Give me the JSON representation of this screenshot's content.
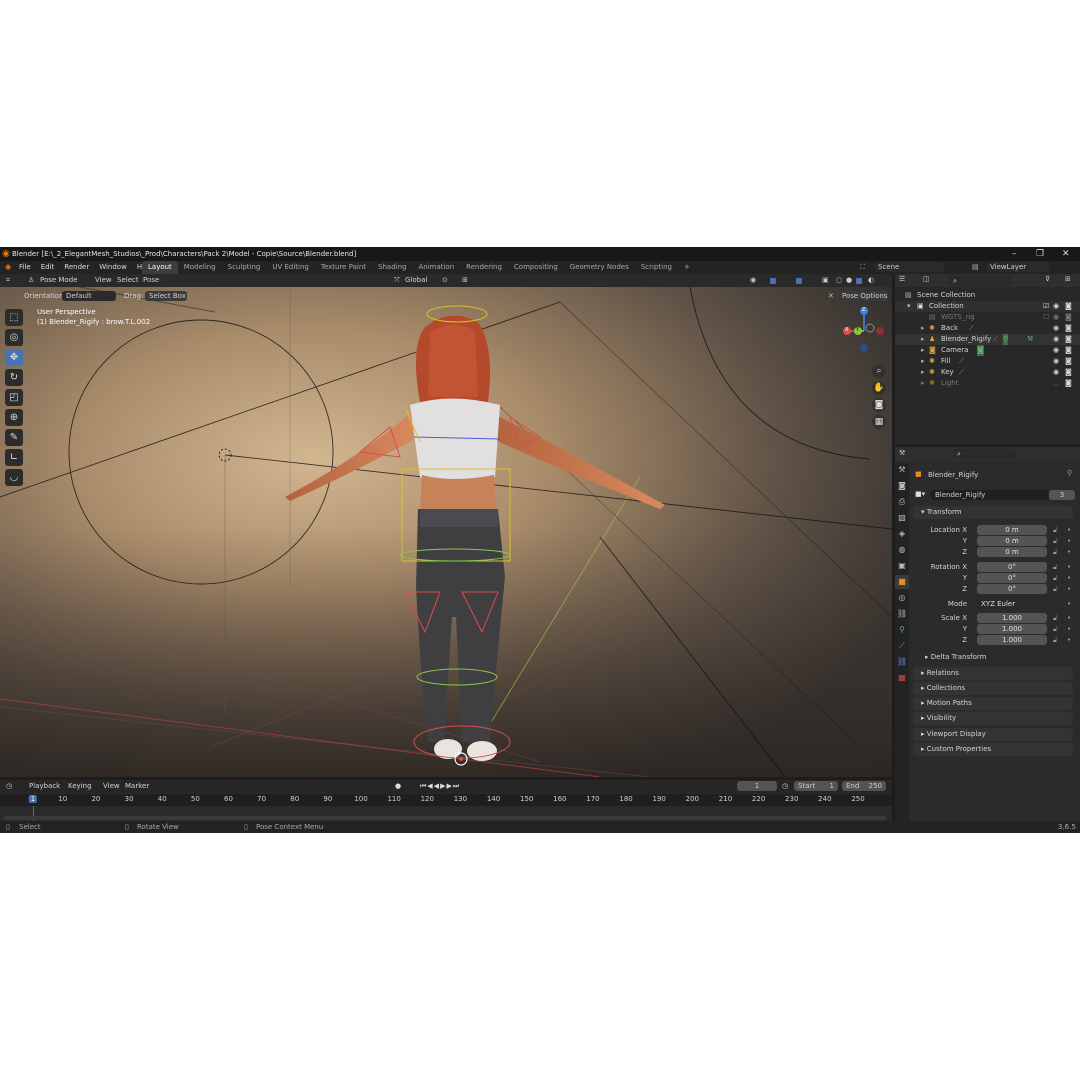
{
  "window": {
    "title": "Blender [E:\\_2_ElegantMesh_Studios\\_Prod\\Characters\\Pack 2\\Model - Copie\\Source\\Blender.blend]",
    "minimize": "–",
    "maximize": "❐",
    "close": "✕"
  },
  "menu": {
    "items": [
      "File",
      "Edit",
      "Render",
      "Window",
      "Help"
    ],
    "workspaces": [
      "Layout",
      "Modeling",
      "Sculpting",
      "UV Editing",
      "Texture Paint",
      "Shading",
      "Animation",
      "Rendering",
      "Compositing",
      "Geometry Nodes",
      "Scripting"
    ],
    "active_workspace": "Layout",
    "add_tab": "+",
    "scene": "Scene",
    "view_layer": "ViewLayer"
  },
  "viewport_header": {
    "mode": "Pose Mode",
    "menus": [
      "View",
      "Select",
      "Pose"
    ],
    "orientation_label": "Orientation:",
    "orientation_value": "Default",
    "drag_label": "Drag:",
    "drag_value": "Select Box",
    "transform_global": "Global",
    "pose_options": "Pose Options"
  },
  "viewport": {
    "perspective": "User Perspective",
    "active_object": "(1) Blender_Rigify : brow.T.L.002",
    "gizmo": {
      "x": "X",
      "y": "Y",
      "z": "Z"
    }
  },
  "outliner": {
    "root": "Scene Collection",
    "collection": "Collection",
    "items": [
      "WGTS_rig",
      "Back",
      "Blender_Rigify",
      "Camera",
      "Fill",
      "Key",
      "Light"
    ]
  },
  "properties": {
    "object_name": "Blender_Rigify",
    "data_name": "Blender_Rigify",
    "users": "3",
    "transform_title": "Transform",
    "location_label": "Location X",
    "location": [
      "0 m",
      "0 m",
      "0 m"
    ],
    "rotation_label": "Rotation X",
    "rotation": [
      "0°",
      "0°",
      "0°"
    ],
    "axis_y": "Y",
    "axis_z": "Z",
    "mode_label": "Mode",
    "mode_value": "XYZ Euler",
    "scale_label": "Scale X",
    "scale": [
      "1.000",
      "1.000",
      "1.000"
    ],
    "delta_transform": "Delta Transform",
    "panels": [
      "Relations",
      "Collections",
      "Motion Paths",
      "Visibility",
      "Viewport Display",
      "Custom Properties"
    ]
  },
  "timeline": {
    "menus": [
      "Playback",
      "Keying",
      "View",
      "Marker"
    ],
    "current_frame": "1",
    "start_label": "Start",
    "start": "1",
    "end_label": "End",
    "end": "250",
    "ticks": [
      "1",
      "10",
      "20",
      "30",
      "40",
      "50",
      "60",
      "70",
      "80",
      "90",
      "100",
      "110",
      "120",
      "130",
      "140",
      "150",
      "160",
      "170",
      "180",
      "190",
      "200",
      "210",
      "220",
      "230",
      "240",
      "250"
    ]
  },
  "statusbar": {
    "select": "Select",
    "rotate": "Rotate View",
    "context": "Pose Context Menu",
    "version": "3.6.5"
  },
  "colors": {
    "accent": "#4772b3",
    "bg": "#1d1d1d",
    "panel": "#2b2b2b",
    "axis_x": "#e44b55",
    "axis_y": "#8bc53f",
    "axis_z": "#3e86e0"
  }
}
